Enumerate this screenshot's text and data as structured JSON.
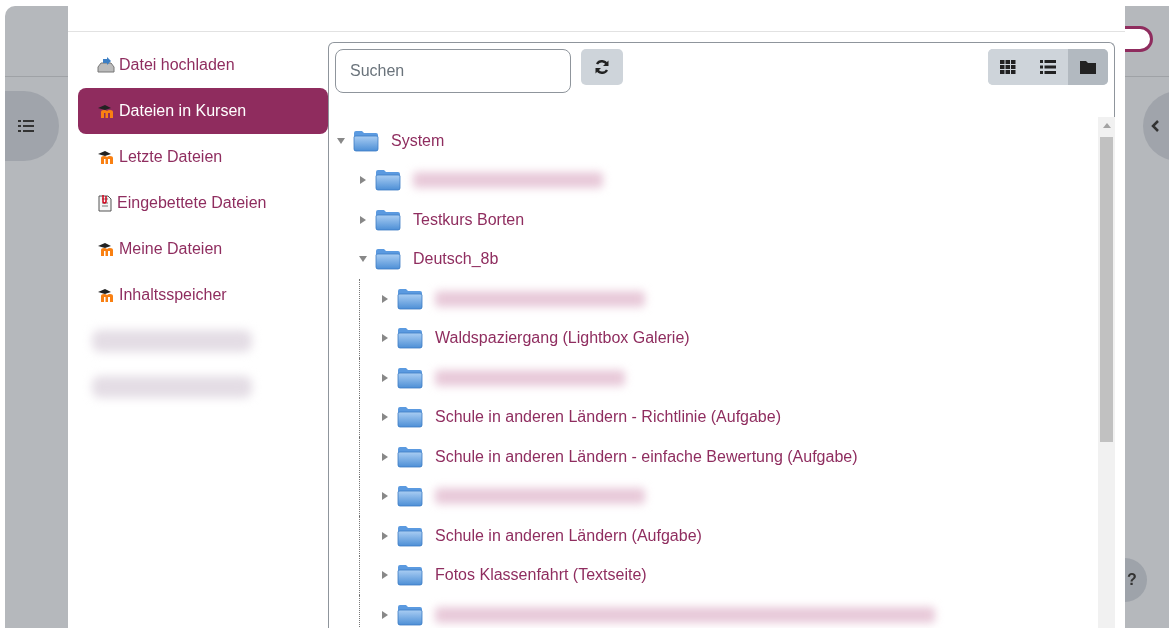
{
  "page_sidebar_toggle": {
    "on": true
  },
  "help_button": {
    "label": "?"
  },
  "sources": [
    {
      "kind": "upload",
      "label": "Datei hochladen",
      "selected": false
    },
    {
      "kind": "moodle",
      "label": "Dateien in Kursen",
      "selected": true
    },
    {
      "kind": "moodle",
      "label": "Letzte Dateien",
      "selected": false
    },
    {
      "kind": "embedded",
      "label": "Eingebettete Dateien",
      "selected": false
    },
    {
      "kind": "moodle",
      "label": "Meine Dateien",
      "selected": false
    },
    {
      "kind": "moodle",
      "label": "Inhaltsspeicher",
      "selected": false
    },
    {
      "kind": "blurred",
      "selected": false
    },
    {
      "kind": "blurred",
      "selected": false
    }
  ],
  "search": {
    "placeholder": "Suchen"
  },
  "view_modes": [
    {
      "kind": "grid",
      "selected": false
    },
    {
      "kind": "list",
      "selected": false
    },
    {
      "kind": "tree",
      "selected": true
    }
  ],
  "tree": {
    "nodes": [
      {
        "label": "System",
        "expanded": true,
        "children": [
          {
            "blurred": true,
            "expanded": false
          },
          {
            "label": "Testkurs Borten",
            "expanded": false
          },
          {
            "label": "Deutsch_8b",
            "expanded": true,
            "children": [
              {
                "blurred": true,
                "expanded": false
              },
              {
                "label": "Waldspaziergang (Lightbox Galerie)",
                "expanded": false
              },
              {
                "blurred": true,
                "expanded": false
              },
              {
                "label": "Schule in anderen Ländern - Richtlinie (Aufgabe)",
                "expanded": false
              },
              {
                "label": "Schule in anderen Ländern - einfache Bewertung (Aufgabe)",
                "expanded": false
              },
              {
                "blurred": true,
                "expanded": false
              },
              {
                "label": "Schule in anderen Ländern (Aufgabe)",
                "expanded": false
              },
              {
                "label": "Fotos Klassenfahrt (Textseite)",
                "expanded": false
              },
              {
                "blurred": true,
                "expanded": false
              }
            ]
          }
        ]
      }
    ]
  }
}
